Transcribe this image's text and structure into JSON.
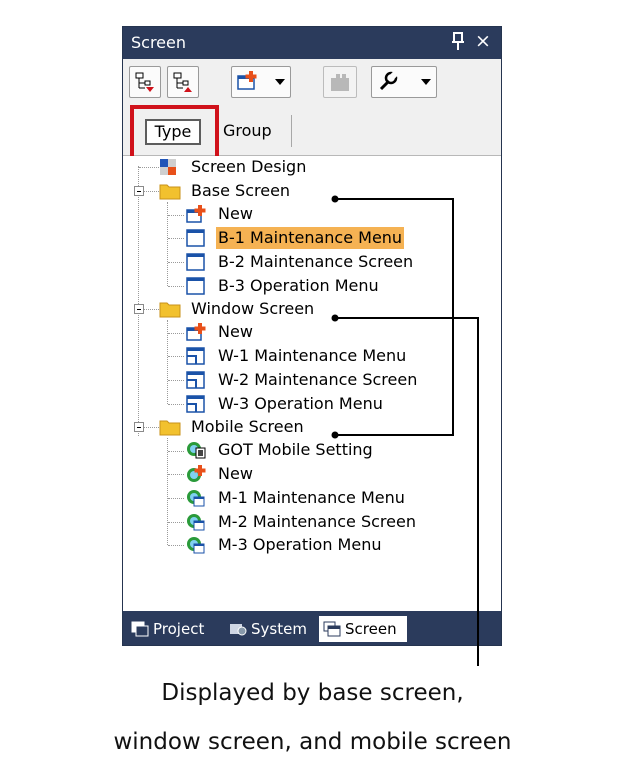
{
  "panel": {
    "title": "Screen",
    "pin_glyph": "📌",
    "close_glyph": "×"
  },
  "toolbar": {
    "buttons": [
      {
        "icon": "tree-expand-icon"
      },
      {
        "icon": "tree-collapse-icon"
      },
      {
        "icon": "new-screen-icon",
        "has_dropdown": true
      },
      {
        "icon": "package-icon",
        "disabled": true
      },
      {
        "icon": "wrench-icon",
        "has_dropdown": true
      }
    ]
  },
  "tabs": {
    "type": "Type",
    "group": "Group"
  },
  "tree": {
    "screen_design": "Screen Design",
    "base_screen": "Base Screen",
    "base_new": "New",
    "b1": "B-1 Maintenance Menu",
    "b2": "B-2 Maintenance Screen",
    "b3": "B-3 Operation Menu",
    "window_screen": "Window Screen",
    "window_new": "New",
    "w1": "W-1 Maintenance Menu",
    "w2": "W-2 Maintenance Screen",
    "w3": "W-3 Operation Menu",
    "mobile_screen": "Mobile Screen",
    "got_mobile": "GOT Mobile Setting",
    "mobile_new": "New",
    "m1": "M-1 Maintenance Menu",
    "m2": "M-2 Maintenance Screen",
    "m3": "M-3 Operation Menu"
  },
  "bottom_tabs": {
    "project": "Project",
    "system": "System",
    "screen": "Screen"
  },
  "colors": {
    "titlebar": "#2b3b5c",
    "selection": "#f5b253",
    "highlight_box": "#d0121b",
    "folder": "#f2c12e"
  },
  "caption": {
    "line1": "Displayed by base screen,",
    "line2": "window screen, and mobile screen"
  }
}
